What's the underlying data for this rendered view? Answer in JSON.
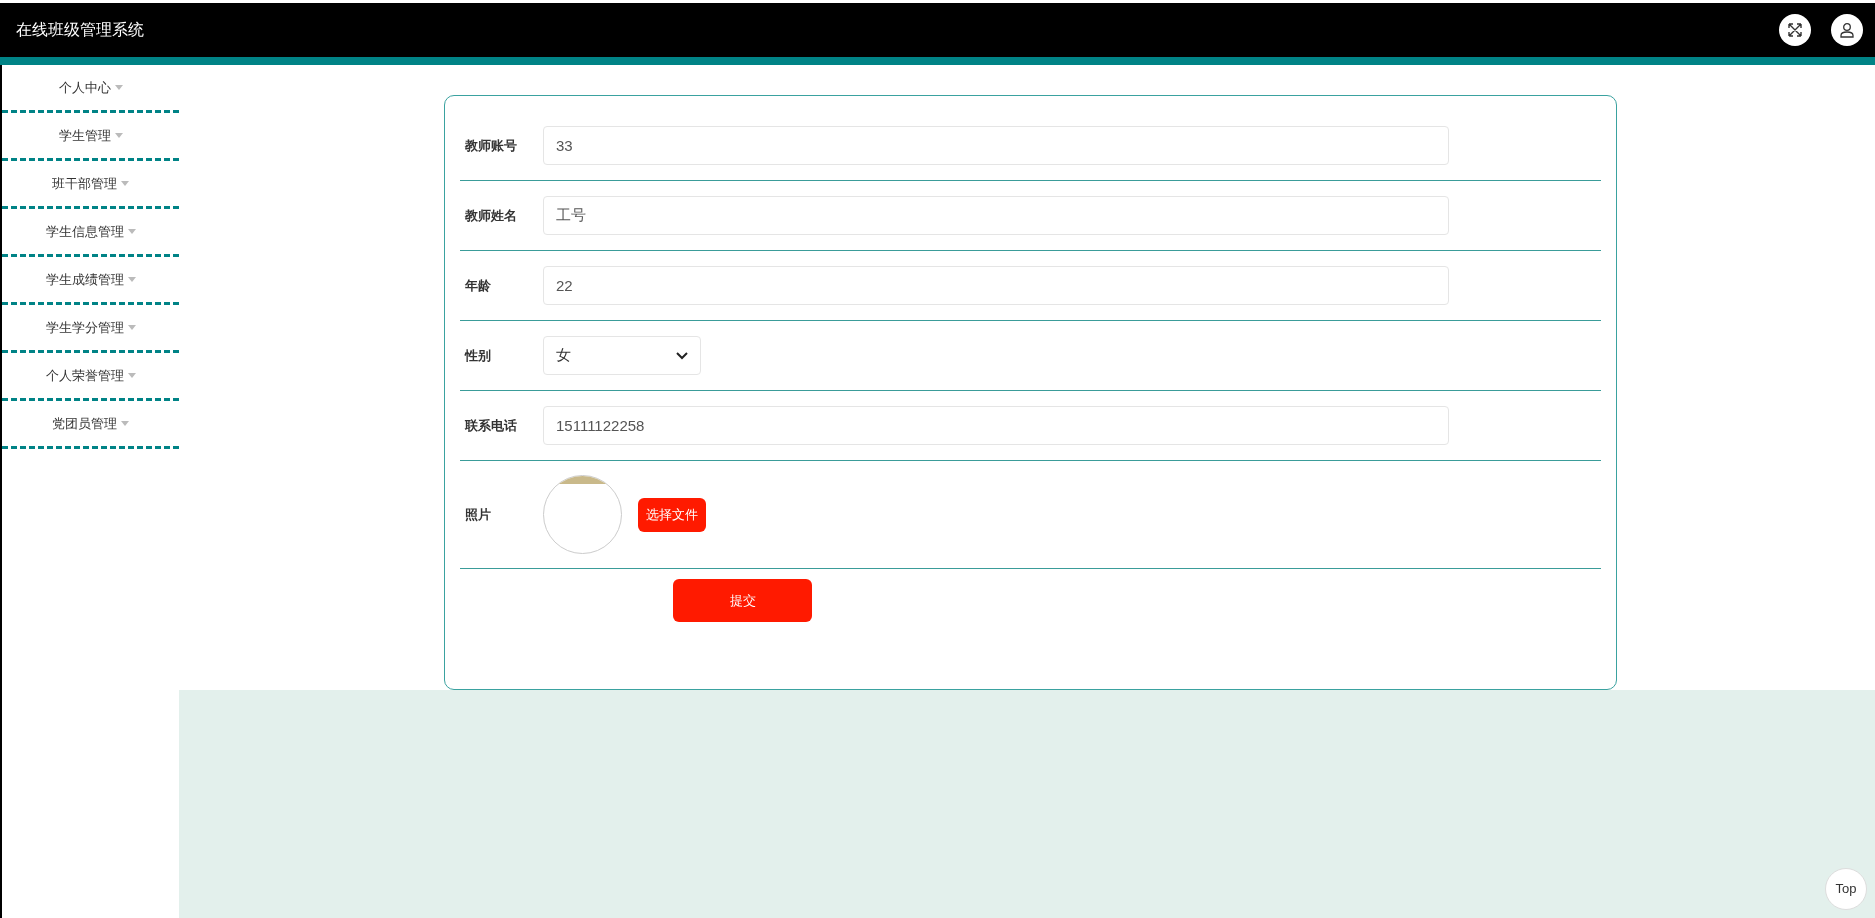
{
  "header": {
    "title": "在线班级管理系统"
  },
  "sidebar": {
    "items": [
      {
        "label": "个人中心"
      },
      {
        "label": "学生管理"
      },
      {
        "label": "班干部管理"
      },
      {
        "label": "学生信息管理"
      },
      {
        "label": "学生成绩管理"
      },
      {
        "label": "学生学分管理"
      },
      {
        "label": "个人荣誉管理"
      },
      {
        "label": "党团员管理"
      }
    ]
  },
  "form": {
    "fields": [
      {
        "kind": "text",
        "label": "教师账号",
        "value": "33"
      },
      {
        "kind": "text",
        "label": "教师姓名",
        "value": "工号"
      },
      {
        "kind": "text",
        "label": "年龄",
        "value": "22"
      },
      {
        "kind": "select",
        "label": "性别",
        "value": "女"
      },
      {
        "kind": "text",
        "label": "联系电话",
        "value": "15111122258"
      },
      {
        "kind": "photo",
        "label": "照片",
        "button": "选择文件"
      }
    ],
    "submit": "提交"
  },
  "back_to_top": "Top"
}
